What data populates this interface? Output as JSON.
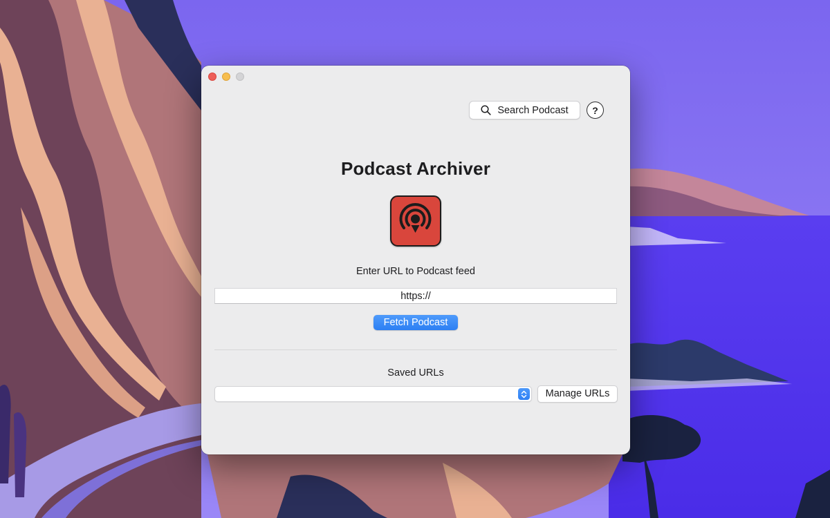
{
  "window": {
    "title": "Podcast Archiver",
    "controls": {
      "close_icon": "close-icon",
      "minimize_icon": "minimize-icon",
      "zoom_icon": "zoom-icon"
    }
  },
  "toolbar": {
    "search_label": "Search Podcast",
    "search_icon": "search-icon",
    "help_label": "?"
  },
  "main": {
    "app_icon": "podcast-icon",
    "url_label": "Enter URL to Podcast feed",
    "url_value": "https://",
    "fetch_label": "Fetch Podcast"
  },
  "saved": {
    "label": "Saved URLs",
    "selected": "",
    "manage_label": "Manage URLs"
  },
  "colors": {
    "accent": "#2c7ff3",
    "app_icon_bg": "#d9463c",
    "window_bg": "#ececed"
  }
}
